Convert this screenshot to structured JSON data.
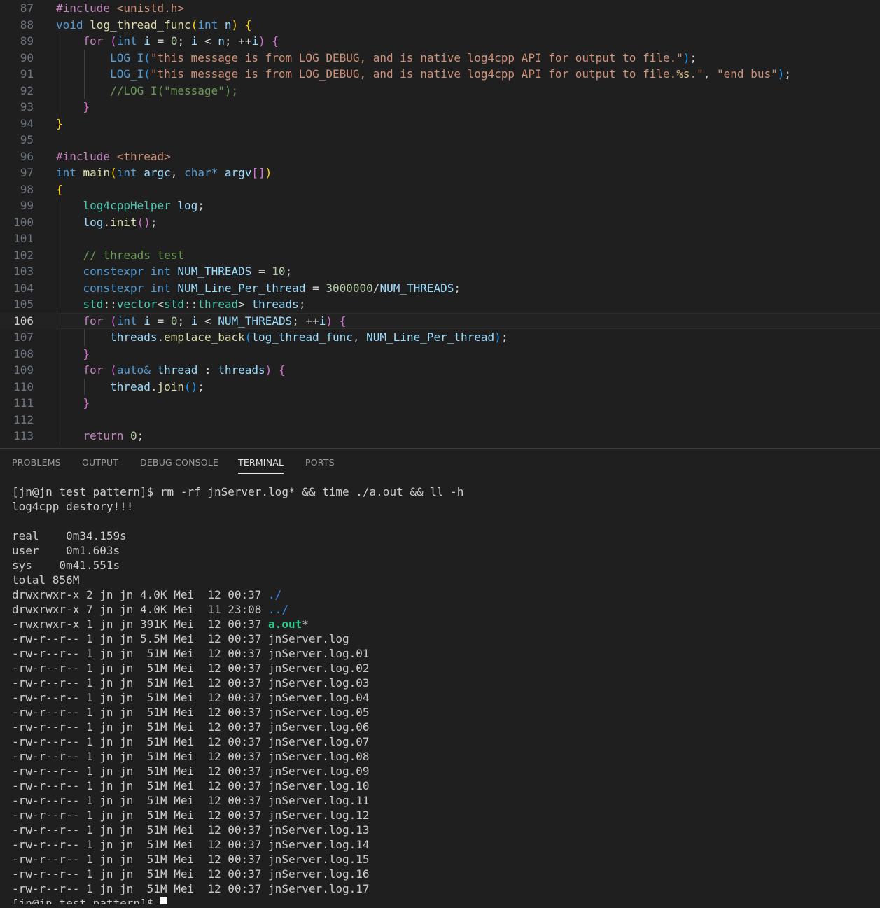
{
  "editor": {
    "lines": [
      {
        "n": "87",
        "tokens": [
          [
            "t-ctl",
            "#include"
          ],
          [
            "t-pun",
            " "
          ],
          [
            "t-str",
            "<unistd.h>"
          ]
        ]
      },
      {
        "n": "88",
        "tokens": [
          [
            "t-kw",
            "void"
          ],
          [
            "t-pun",
            " "
          ],
          [
            "t-fn",
            "log_thread_func"
          ],
          [
            "t-b1",
            "("
          ],
          [
            "t-kw",
            "int"
          ],
          [
            "t-pun",
            " "
          ],
          [
            "t-var",
            "n"
          ],
          [
            "t-b1",
            ")"
          ],
          [
            "t-pun",
            " "
          ],
          [
            "t-b1",
            "{"
          ]
        ]
      },
      {
        "n": "89",
        "guides": [
          1
        ],
        "tokens": [
          [
            "t-pun",
            "    "
          ],
          [
            "t-ctl",
            "for"
          ],
          [
            "t-pun",
            " "
          ],
          [
            "t-b2",
            "("
          ],
          [
            "t-kw",
            "int"
          ],
          [
            "t-pun",
            " "
          ],
          [
            "t-var",
            "i"
          ],
          [
            "t-pun",
            " = "
          ],
          [
            "t-num",
            "0"
          ],
          [
            "t-pun",
            "; "
          ],
          [
            "t-var",
            "i"
          ],
          [
            "t-pun",
            " < "
          ],
          [
            "t-var",
            "n"
          ],
          [
            "t-pun",
            "; ++"
          ],
          [
            "t-var",
            "i"
          ],
          [
            "t-b2",
            ")"
          ],
          [
            "t-pun",
            " "
          ],
          [
            "t-b2",
            "{"
          ]
        ]
      },
      {
        "n": "90",
        "guides": [
          1,
          2
        ],
        "tokens": [
          [
            "t-pun",
            "        "
          ],
          [
            "t-mac",
            "LOG_I"
          ],
          [
            "t-b3",
            "("
          ],
          [
            "t-str",
            "\"this message is from LOG_DEBUG, and is native log4cpp API for output to file.\""
          ],
          [
            "t-b3",
            ")"
          ],
          [
            "t-pun",
            ";"
          ]
        ]
      },
      {
        "n": "91",
        "guides": [
          1,
          2
        ],
        "tokens": [
          [
            "t-pun",
            "        "
          ],
          [
            "t-mac",
            "LOG_I"
          ],
          [
            "t-b3",
            "("
          ],
          [
            "t-str",
            "\"this message is from LOG_DEBUG, and is native log4cpp API for output to file."
          ],
          [
            "t-esc",
            "%s"
          ],
          [
            "t-str",
            ".\""
          ],
          [
            "t-pun",
            ", "
          ],
          [
            "t-str",
            "\"end bus\""
          ],
          [
            "t-b3",
            ")"
          ],
          [
            "t-pun",
            ";"
          ]
        ]
      },
      {
        "n": "92",
        "guides": [
          1,
          2
        ],
        "tokens": [
          [
            "t-pun",
            "        "
          ],
          [
            "t-cmt",
            "//LOG_I(\"message\");"
          ]
        ]
      },
      {
        "n": "93",
        "guides": [
          1
        ],
        "tokens": [
          [
            "t-pun",
            "    "
          ],
          [
            "t-b2",
            "}"
          ]
        ]
      },
      {
        "n": "94",
        "tokens": [
          [
            "t-b1",
            "}"
          ]
        ]
      },
      {
        "n": "95",
        "tokens": []
      },
      {
        "n": "96",
        "tokens": [
          [
            "t-ctl",
            "#include"
          ],
          [
            "t-pun",
            " "
          ],
          [
            "t-str",
            "<thread>"
          ]
        ]
      },
      {
        "n": "97",
        "tokens": [
          [
            "t-kw",
            "int"
          ],
          [
            "t-pun",
            " "
          ],
          [
            "t-fn",
            "main"
          ],
          [
            "t-b1",
            "("
          ],
          [
            "t-kw",
            "int"
          ],
          [
            "t-pun",
            " "
          ],
          [
            "t-var",
            "argc"
          ],
          [
            "t-pun",
            ", "
          ],
          [
            "t-kw",
            "char*"
          ],
          [
            "t-pun",
            " "
          ],
          [
            "t-var",
            "argv"
          ],
          [
            "t-b2",
            "[]"
          ],
          [
            "t-b1",
            ")"
          ]
        ]
      },
      {
        "n": "98",
        "tokens": [
          [
            "t-b1",
            "{"
          ]
        ]
      },
      {
        "n": "99",
        "guides": [
          1
        ],
        "tokens": [
          [
            "t-pun",
            "    "
          ],
          [
            "t-type",
            "log4cppHelper"
          ],
          [
            "t-pun",
            " "
          ],
          [
            "t-var",
            "log"
          ],
          [
            "t-pun",
            ";"
          ]
        ]
      },
      {
        "n": "100",
        "guides": [
          1
        ],
        "tokens": [
          [
            "t-pun",
            "    "
          ],
          [
            "t-var",
            "log"
          ],
          [
            "t-pun",
            "."
          ],
          [
            "t-fn",
            "init"
          ],
          [
            "t-b2",
            "()"
          ],
          [
            "t-pun",
            ";"
          ]
        ]
      },
      {
        "n": "101",
        "guides": [
          1
        ],
        "tokens": []
      },
      {
        "n": "102",
        "guides": [
          1
        ],
        "tokens": [
          [
            "t-pun",
            "    "
          ],
          [
            "t-cmt",
            "// threads test"
          ]
        ]
      },
      {
        "n": "103",
        "guides": [
          1
        ],
        "tokens": [
          [
            "t-pun",
            "    "
          ],
          [
            "t-kw",
            "constexpr"
          ],
          [
            "t-pun",
            " "
          ],
          [
            "t-kw",
            "int"
          ],
          [
            "t-pun",
            " "
          ],
          [
            "t-var",
            "NUM_THREADS"
          ],
          [
            "t-pun",
            " = "
          ],
          [
            "t-num",
            "10"
          ],
          [
            "t-pun",
            ";"
          ]
        ]
      },
      {
        "n": "104",
        "guides": [
          1
        ],
        "tokens": [
          [
            "t-pun",
            "    "
          ],
          [
            "t-kw",
            "constexpr"
          ],
          [
            "t-pun",
            " "
          ],
          [
            "t-kw",
            "int"
          ],
          [
            "t-pun",
            " "
          ],
          [
            "t-var",
            "NUM_Line_Per_thread"
          ],
          [
            "t-pun",
            " = "
          ],
          [
            "t-num",
            "3000000"
          ],
          [
            "t-pun",
            "/"
          ],
          [
            "t-var",
            "NUM_THREADS"
          ],
          [
            "t-pun",
            ";"
          ]
        ]
      },
      {
        "n": "105",
        "guides": [
          1
        ],
        "tokens": [
          [
            "t-pun",
            "    "
          ],
          [
            "t-type",
            "std"
          ],
          [
            "t-pun",
            "::"
          ],
          [
            "t-type",
            "vector"
          ],
          [
            "t-pun",
            "<"
          ],
          [
            "t-type",
            "std"
          ],
          [
            "t-pun",
            "::"
          ],
          [
            "t-type",
            "thread"
          ],
          [
            "t-pun",
            "> "
          ],
          [
            "t-var",
            "threads"
          ],
          [
            "t-pun",
            ";"
          ]
        ]
      },
      {
        "n": "106",
        "active": true,
        "guides": [
          1
        ],
        "tokens": [
          [
            "t-pun",
            "    "
          ],
          [
            "t-ctl",
            "for"
          ],
          [
            "t-pun",
            " "
          ],
          [
            "t-b2",
            "("
          ],
          [
            "t-kw",
            "int"
          ],
          [
            "t-pun",
            " "
          ],
          [
            "t-var",
            "i"
          ],
          [
            "t-pun",
            " = "
          ],
          [
            "t-num",
            "0"
          ],
          [
            "t-pun",
            "; "
          ],
          [
            "t-var",
            "i"
          ],
          [
            "t-pun",
            " < "
          ],
          [
            "t-var",
            "NUM_THREADS"
          ],
          [
            "t-pun",
            "; ++"
          ],
          [
            "t-var",
            "i"
          ],
          [
            "t-b2",
            ")"
          ],
          [
            "t-pun",
            " "
          ],
          [
            "t-b2",
            "{"
          ]
        ]
      },
      {
        "n": "107",
        "guides": [
          1,
          2
        ],
        "tokens": [
          [
            "t-pun",
            "        "
          ],
          [
            "t-var",
            "threads"
          ],
          [
            "t-pun",
            "."
          ],
          [
            "t-fn",
            "emplace_back"
          ],
          [
            "t-b3",
            "("
          ],
          [
            "t-var",
            "log_thread_func"
          ],
          [
            "t-pun",
            ", "
          ],
          [
            "t-var",
            "NUM_Line_Per_thread"
          ],
          [
            "t-b3",
            ")"
          ],
          [
            "t-pun",
            ";"
          ]
        ]
      },
      {
        "n": "108",
        "guides": [
          1
        ],
        "tokens": [
          [
            "t-pun",
            "    "
          ],
          [
            "t-b2",
            "}"
          ]
        ]
      },
      {
        "n": "109",
        "guides": [
          1
        ],
        "tokens": [
          [
            "t-pun",
            "    "
          ],
          [
            "t-ctl",
            "for"
          ],
          [
            "t-pun",
            " "
          ],
          [
            "t-b2",
            "("
          ],
          [
            "t-kw",
            "auto&"
          ],
          [
            "t-pun",
            " "
          ],
          [
            "t-var",
            "thread"
          ],
          [
            "t-pun",
            " : "
          ],
          [
            "t-var",
            "threads"
          ],
          [
            "t-b2",
            ")"
          ],
          [
            "t-pun",
            " "
          ],
          [
            "t-b2",
            "{"
          ]
        ]
      },
      {
        "n": "110",
        "guides": [
          1,
          2
        ],
        "tokens": [
          [
            "t-pun",
            "        "
          ],
          [
            "t-var",
            "thread"
          ],
          [
            "t-pun",
            "."
          ],
          [
            "t-fn",
            "join"
          ],
          [
            "t-b3",
            "()"
          ],
          [
            "t-pun",
            ";"
          ]
        ]
      },
      {
        "n": "111",
        "guides": [
          1
        ],
        "tokens": [
          [
            "t-pun",
            "    "
          ],
          [
            "t-b2",
            "}"
          ]
        ]
      },
      {
        "n": "112",
        "guides": [
          1
        ],
        "tokens": []
      },
      {
        "n": "113",
        "guides": [
          1
        ],
        "tokens": [
          [
            "t-pun",
            "    "
          ],
          [
            "t-ctl",
            "return"
          ],
          [
            "t-pun",
            " "
          ],
          [
            "t-num",
            "0"
          ],
          [
            "t-pun",
            ";"
          ]
        ]
      }
    ]
  },
  "panel": {
    "tabs": [
      {
        "id": "problems",
        "label": "PROBLEMS",
        "active": false
      },
      {
        "id": "output",
        "label": "OUTPUT",
        "active": false
      },
      {
        "id": "debug-console",
        "label": "DEBUG CONSOLE",
        "active": false
      },
      {
        "id": "terminal",
        "label": "TERMINAL",
        "active": true
      },
      {
        "id": "ports",
        "label": "PORTS",
        "active": false
      }
    ]
  },
  "terminal": {
    "lines": [
      [
        [
          "",
          "[jn@jn test_pattern]$ rm -rf jnServer.log* && time ./a.out && ll -h"
        ]
      ],
      [
        [
          "",
          "log4cpp destory!!!"
        ]
      ],
      [
        [
          "",
          ""
        ]
      ],
      [
        [
          "",
          "real\t0m34.159s"
        ]
      ],
      [
        [
          "",
          "user\t0m1.603s"
        ]
      ],
      [
        [
          "",
          "sys\t0m41.551s"
        ]
      ],
      [
        [
          "",
          "total 856M"
        ]
      ],
      [
        [
          "",
          "drwxrwxr-x 2 jn jn 4.0K Mei  12 00:37 "
        ],
        [
          "c-blue",
          "./"
        ]
      ],
      [
        [
          "",
          "drwxrwxr-x 7 jn jn 4.0K Mei  11 23:08 "
        ],
        [
          "c-blue",
          "../"
        ]
      ],
      [
        [
          "",
          "-rwxrwxr-x 1 jn jn 391K Mei  12 00:37 "
        ],
        [
          "c-green",
          "a.out"
        ],
        [
          "",
          "*"
        ]
      ],
      [
        [
          "",
          "-rw-r--r-- 1 jn jn 5.5M Mei  12 00:37 jnServer.log"
        ]
      ],
      [
        [
          "",
          "-rw-r--r-- 1 jn jn  51M Mei  12 00:37 jnServer.log.01"
        ]
      ],
      [
        [
          "",
          "-rw-r--r-- 1 jn jn  51M Mei  12 00:37 jnServer.log.02"
        ]
      ],
      [
        [
          "",
          "-rw-r--r-- 1 jn jn  51M Mei  12 00:37 jnServer.log.03"
        ]
      ],
      [
        [
          "",
          "-rw-r--r-- 1 jn jn  51M Mei  12 00:37 jnServer.log.04"
        ]
      ],
      [
        [
          "",
          "-rw-r--r-- 1 jn jn  51M Mei  12 00:37 jnServer.log.05"
        ]
      ],
      [
        [
          "",
          "-rw-r--r-- 1 jn jn  51M Mei  12 00:37 jnServer.log.06"
        ]
      ],
      [
        [
          "",
          "-rw-r--r-- 1 jn jn  51M Mei  12 00:37 jnServer.log.07"
        ]
      ],
      [
        [
          "",
          "-rw-r--r-- 1 jn jn  51M Mei  12 00:37 jnServer.log.08"
        ]
      ],
      [
        [
          "",
          "-rw-r--r-- 1 jn jn  51M Mei  12 00:37 jnServer.log.09"
        ]
      ],
      [
        [
          "",
          "-rw-r--r-- 1 jn jn  51M Mei  12 00:37 jnServer.log.10"
        ]
      ],
      [
        [
          "",
          "-rw-r--r-- 1 jn jn  51M Mei  12 00:37 jnServer.log.11"
        ]
      ],
      [
        [
          "",
          "-rw-r--r-- 1 jn jn  51M Mei  12 00:37 jnServer.log.12"
        ]
      ],
      [
        [
          "",
          "-rw-r--r-- 1 jn jn  51M Mei  12 00:37 jnServer.log.13"
        ]
      ],
      [
        [
          "",
          "-rw-r--r-- 1 jn jn  51M Mei  12 00:37 jnServer.log.14"
        ]
      ],
      [
        [
          "",
          "-rw-r--r-- 1 jn jn  51M Mei  12 00:37 jnServer.log.15"
        ]
      ],
      [
        [
          "",
          "-rw-r--r-- 1 jn jn  51M Mei  12 00:37 jnServer.log.16"
        ]
      ],
      [
        [
          "",
          "-rw-r--r-- 1 jn jn  51M Mei  12 00:37 jnServer.log.17"
        ]
      ]
    ],
    "prompt": "[jn@jn test_pattern]$ "
  }
}
